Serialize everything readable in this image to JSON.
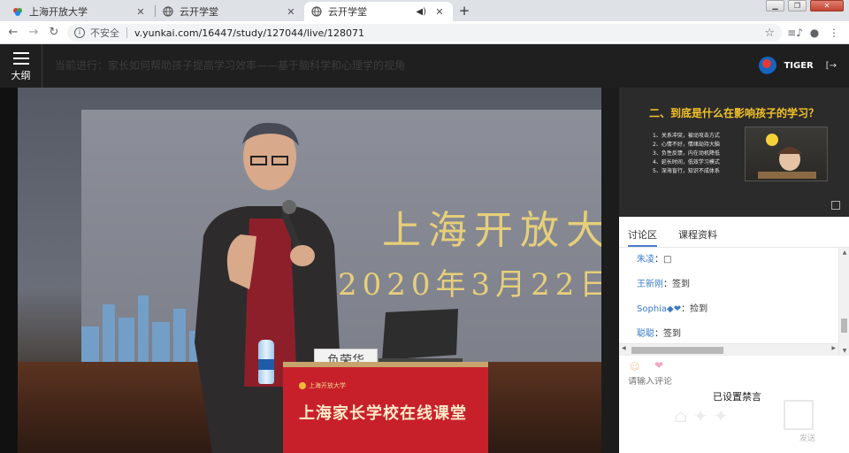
{
  "browser": {
    "tabs": [
      {
        "title": "上海开放大学"
      },
      {
        "title": "云开学堂"
      },
      {
        "title": "云开学堂",
        "active": true
      }
    ],
    "address": {
      "security": "不安全",
      "url": "v.yunkai.com/16447/study/127044/live/128071"
    }
  },
  "header": {
    "menu_label": "大纲",
    "now_playing": "当前进行：家长如何帮助孩子提高学习效率——基于脑科学和心理学的视角",
    "user_name": "TIGER"
  },
  "video": {
    "screen_title": "上海开放大学",
    "screen_date": "2020年3月22日",
    "podium_banner": "上海家长学校在线课堂",
    "podium_logo": "上海开放大学",
    "name_card": "负荣华"
  },
  "slide": {
    "title": "二、到底是什么在影响孩子的学习？",
    "bullets": [
      "1、关系冲突，被动攻击方式",
      "2、心情不好，情绪劫持大脑",
      "3、负性反馈，内在动机降低",
      "4、延长时间，低效学习模式",
      "5、深海盲行，知识不成体系"
    ]
  },
  "panel": {
    "tabs": [
      "讨论区",
      "课程资料"
    ],
    "messages": [
      {
        "user": "朱凌",
        "text": "□"
      },
      {
        "user": "王新刚",
        "text": "签到"
      },
      {
        "user": "Sophia◆❤",
        "text": "捡到"
      },
      {
        "user": "聪聪",
        "text": "签到"
      }
    ],
    "separator": "：",
    "input_placeholder": "请输入评论",
    "muted_notice": "已设置禁言",
    "send_label": "发送"
  },
  "colors": {
    "accent": "#4a7bd0",
    "chat_user": "#3a7bc8",
    "slide_title": "#f4c22b",
    "podium": "#c8202b"
  }
}
